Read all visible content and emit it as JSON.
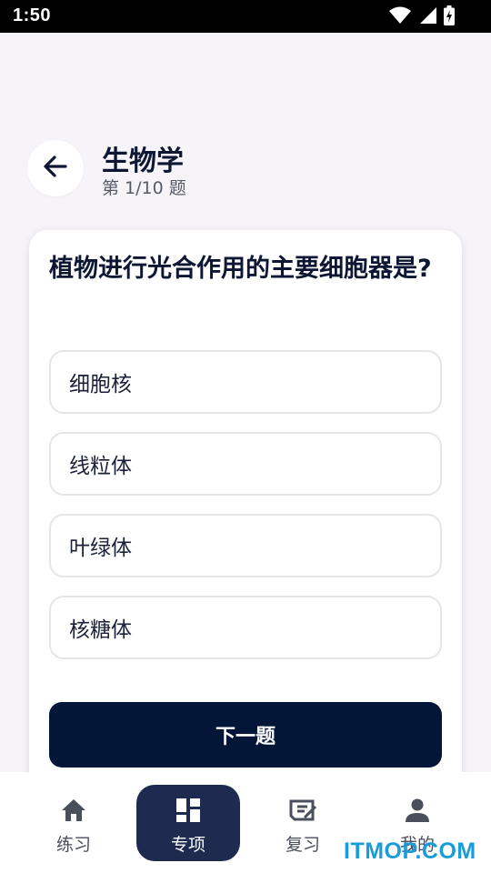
{
  "status_bar": {
    "time": "1:50",
    "icons": [
      "wifi-icon",
      "signal-icon",
      "battery-charging-icon"
    ]
  },
  "header": {
    "back_icon": "arrow-left-icon",
    "title": "生物学",
    "progress": "第 1/10 题"
  },
  "question": {
    "text": "植物进行光合作用的主要细胞器是?",
    "options": [
      "细胞核",
      "线粒体",
      "叶绿体",
      "核糖体"
    ]
  },
  "next_button": {
    "label": "下一题"
  },
  "bottom_nav": {
    "items": [
      {
        "label": "练习",
        "icon": "home-icon",
        "active": false
      },
      {
        "label": "专项",
        "icon": "dashboard-icon",
        "active": true
      },
      {
        "label": "复习",
        "icon": "review-icon",
        "active": false
      },
      {
        "label": "我的",
        "icon": "person-icon",
        "active": false
      }
    ]
  },
  "watermark": {
    "text": "ITMOP.COM"
  },
  "colors": {
    "primary": "#041637",
    "active_nav": "#1e2a4f",
    "background": "#f6f4f9",
    "watermark": "#1a9cd8"
  }
}
